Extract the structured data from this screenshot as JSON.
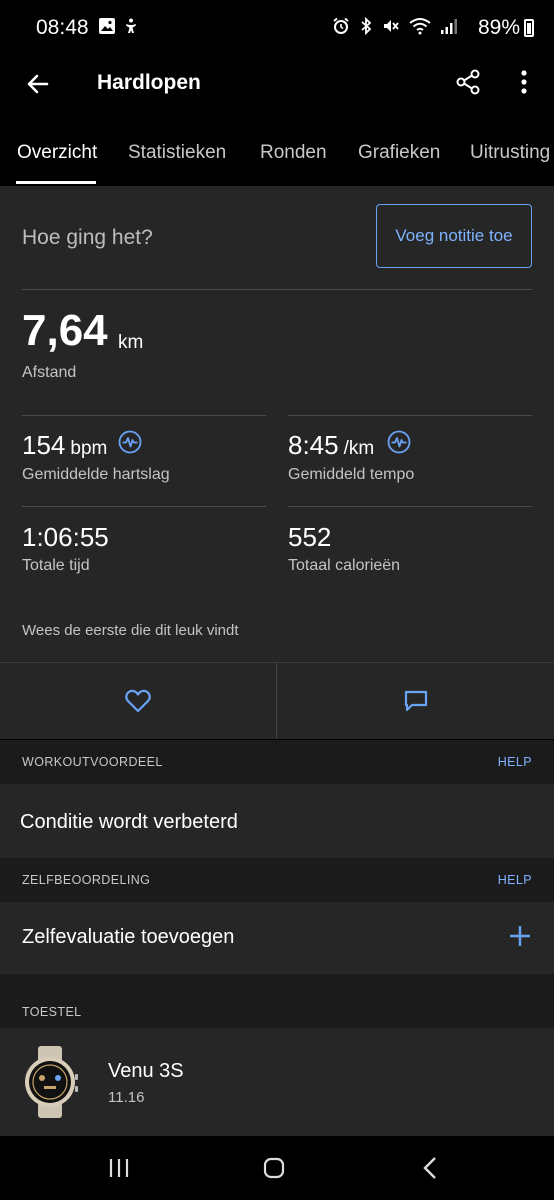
{
  "status_bar": {
    "time": "08:48",
    "battery": "89%",
    "icons_left": [
      "image-icon",
      "accessibility-icon"
    ],
    "icons_right": [
      "alarm-icon",
      "bluetooth-icon",
      "mute-icon",
      "wifi-icon",
      "signal-icon"
    ]
  },
  "app_bar": {
    "title": "Hardlopen"
  },
  "tabs": [
    {
      "label": "Overzicht",
      "active": true
    },
    {
      "label": "Statistieken"
    },
    {
      "label": "Ronden"
    },
    {
      "label": "Grafieken"
    },
    {
      "label": "Uitrusting"
    }
  ],
  "feedback": {
    "prompt": "Hoe ging het?",
    "add_note_label": "Voeg notitie toe"
  },
  "distance": {
    "value": "7,64",
    "unit": "km",
    "label": "Afstand"
  },
  "stats": {
    "heart_rate": {
      "value": "154",
      "unit": "bpm",
      "label": "Gemiddelde hartslag"
    },
    "pace": {
      "value": "8:45",
      "unit": "/km",
      "label": "Gemiddeld tempo"
    },
    "total_time": {
      "value": "1:06:55",
      "label": "Totale tijd"
    },
    "calories": {
      "value": "552",
      "label": "Totaal calorieën"
    }
  },
  "social": {
    "like_prompt": "Wees de eerste die dit leuk vindt"
  },
  "workout_benefit": {
    "header": "WORKOUTVOORDEEL",
    "help": "HELP",
    "text": "Conditie wordt verbeterd"
  },
  "self_eval": {
    "header": "ZELFBEOORDELING",
    "help": "HELP",
    "text": "Zelfevaluatie toevoegen"
  },
  "device": {
    "header": "TOESTEL",
    "name": "Venu 3S",
    "version": "11.16"
  },
  "colors": {
    "accent": "#7fb2ff",
    "card": "#262626",
    "section_bg": "#1b1b1b",
    "background": "#000000"
  }
}
